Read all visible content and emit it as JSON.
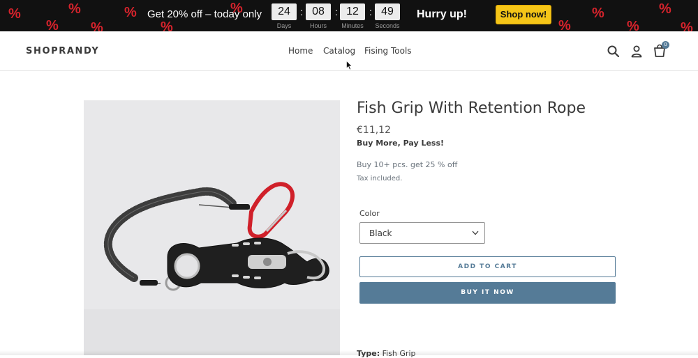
{
  "promo_bar": {
    "text": "Get 20% off – today only",
    "decoration_symbol": "%",
    "countdown": [
      {
        "value": "24",
        "label": "Days"
      },
      {
        "value": "08",
        "label": "Hours"
      },
      {
        "value": "12",
        "label": "Minutes"
      },
      {
        "value": "49",
        "label": "Seconds"
      }
    ],
    "separator": ":",
    "hurry": "Hurry up!",
    "cta": "Shop now!",
    "colors": {
      "background": "#111111",
      "symbol": "#d6232c",
      "cta": "#f5c518"
    }
  },
  "header": {
    "logo": "SHOPRANDY",
    "nav": [
      {
        "label": "Home"
      },
      {
        "label": "Catalog"
      },
      {
        "label": "Fising Tools"
      }
    ],
    "icons": [
      "search-icon",
      "account-icon",
      "cart-icon"
    ],
    "cart_count": "0"
  },
  "product": {
    "title": "Fish Grip With Retention Rope",
    "price": "€11,12",
    "promo": "Buy More, Pay Less!",
    "bulk_offer": "Buy 10+ pcs. get 25 % off",
    "tax_note": "Tax included.",
    "color_label": "Color",
    "color_selected": "Black",
    "add_to_cart": "ADD TO CART",
    "buy_now": "BUY IT NOW",
    "type_label": "Type:",
    "type_value": "Fish Grip",
    "accent_color": "#557b97"
  }
}
